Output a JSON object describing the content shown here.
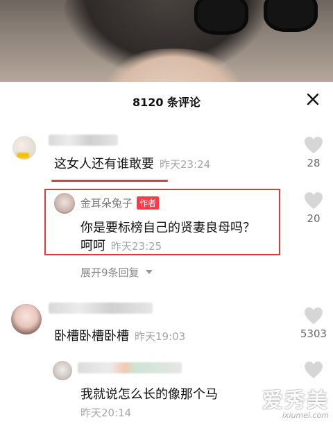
{
  "sheet": {
    "title": "8120 条评论"
  },
  "comments": [
    {
      "text": "这女人还有谁敢要",
      "time": "昨天23:24",
      "likes": "28"
    },
    {
      "author": "金耳朵兔子",
      "author_tag": "作者",
      "text_line1": "你是要标榜自己的贤妻良母吗？",
      "text_line2": "呵呵",
      "time": "昨天23:25",
      "likes": "20"
    },
    {
      "expand_label": "展开9条回复"
    },
    {
      "text": "卧槽卧槽卧槽",
      "time": "昨天19:03",
      "likes": "5303"
    },
    {
      "text": "我就说怎么长的像那个马",
      "time": "昨天20:14"
    }
  ],
  "watermark": {
    "main": "爱秀美",
    "sub": "ixiumei.com"
  },
  "colors": {
    "highlight_red": "#e53935",
    "author_tag_bg": "#ff3b4a",
    "timestamp_gray": "#a6a6a6"
  }
}
